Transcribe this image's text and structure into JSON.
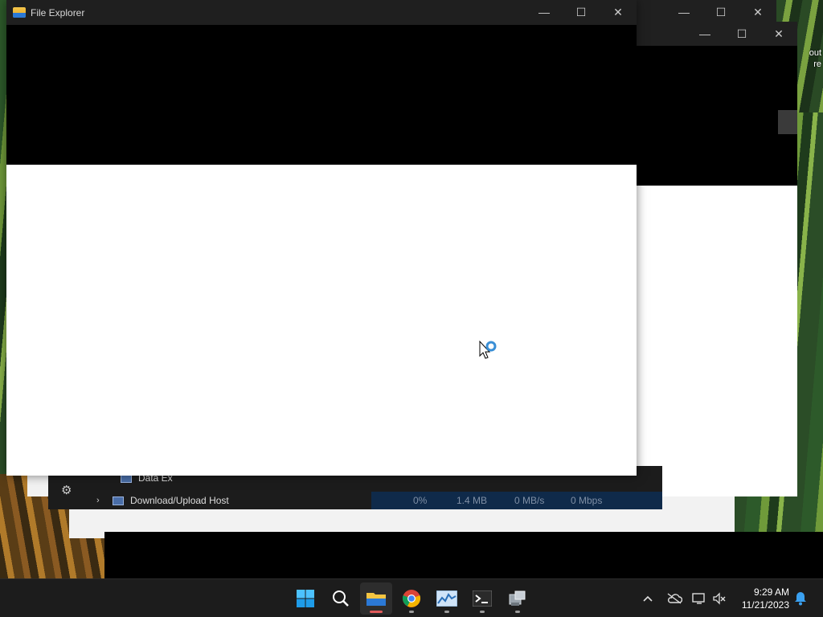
{
  "desktop": {
    "partial_text_1": "out",
    "partial_text_2": "re"
  },
  "explorer": {
    "title": "File Explorer",
    "minimize": "—",
    "maximize": "☐",
    "close": "✕"
  },
  "back_windows": {
    "minimize": "—",
    "maximize": "☐",
    "close": "✕"
  },
  "task_manager": {
    "row_partial": "Data Ex",
    "row_label": "Download/Upload Host",
    "cpu": "0%",
    "memory": "1.4 MB",
    "disk": "0 MB/s",
    "network": "0 Mbps"
  },
  "taskbar": {
    "pinned": [
      {
        "name": "start",
        "icon": "windows-logo"
      },
      {
        "name": "search",
        "icon": "search-icon"
      },
      {
        "name": "file-explorer",
        "icon": "folder-icon",
        "active": true
      },
      {
        "name": "chrome",
        "icon": "chrome-icon"
      },
      {
        "name": "resource-monitor",
        "icon": "chart-icon"
      },
      {
        "name": "terminal",
        "icon": "terminal-icon"
      },
      {
        "name": "network-app",
        "icon": "network-icon"
      }
    ],
    "clock_time": "9:29 AM",
    "clock_date": "11/21/2023"
  },
  "colors": {
    "accent": "#0078d4",
    "active_indicator": "#e05a5a"
  }
}
